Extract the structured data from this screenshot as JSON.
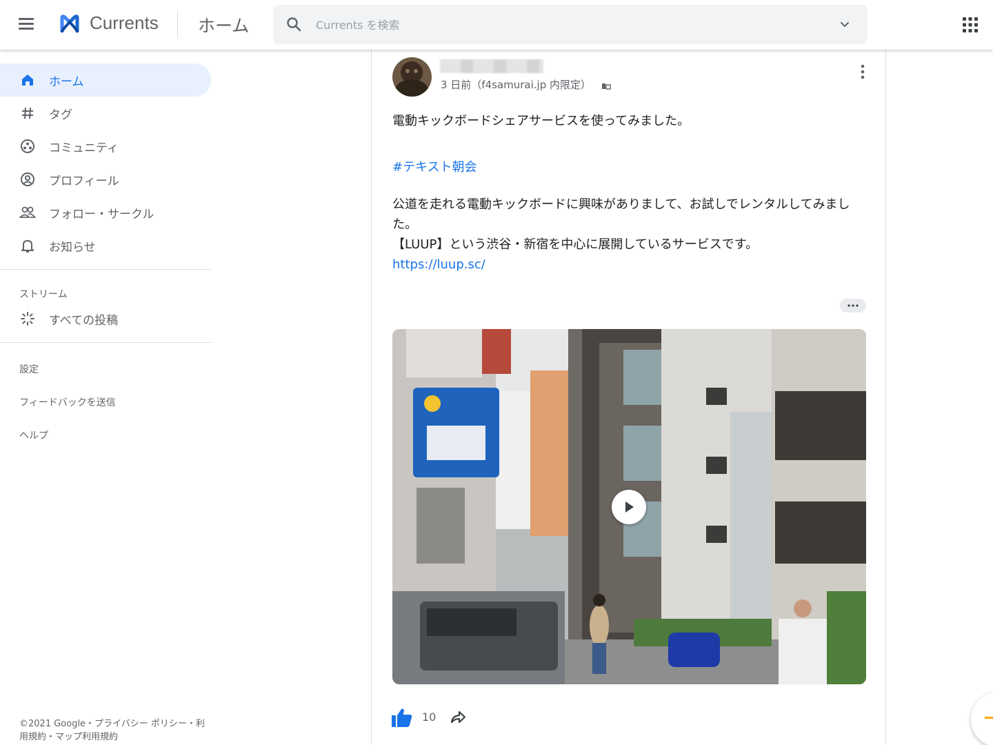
{
  "header": {
    "brand": "Currents",
    "page_title": "ホーム",
    "search_placeholder": "Currents を検索"
  },
  "sidebar": {
    "items": [
      {
        "label": "ホーム",
        "icon": "home-icon",
        "active": true
      },
      {
        "label": "タグ",
        "icon": "hash-icon"
      },
      {
        "label": "コミュニティ",
        "icon": "community-icon"
      },
      {
        "label": "プロフィール",
        "icon": "profile-icon"
      },
      {
        "label": "フォロー・サークル",
        "icon": "people-icon"
      },
      {
        "label": "お知らせ",
        "icon": "bell-icon"
      }
    ],
    "streams_label": "ストリーム",
    "all_posts": {
      "label": "すべての投稿",
      "icon": "sparkle-icon"
    },
    "links": [
      "設定",
      "フィードバックを送信",
      "ヘルプ"
    ],
    "footer": "©2021 Google・プライバシー ポリシー・利用規約・マップ利用規約"
  },
  "post": {
    "meta": "3 日前（f4samurai.jp 内限定）",
    "meta_icon": "domain-icon",
    "title": "電動キックボードシェアサービスを使ってみました。",
    "hashtag": "#テキスト朝会",
    "body_line1": "公道を走れる電動キックボードに興味がありまして、お試しでレンタルしてみました。",
    "body_line2": "【LUUP】という渋谷・新宿を中心に展開しているサービスです。",
    "link": "https://luup.sc/",
    "likes": "10"
  },
  "colors": {
    "accent": "#1a73e8",
    "active_bg": "#e8f0fe",
    "muted": "#5f6368"
  }
}
